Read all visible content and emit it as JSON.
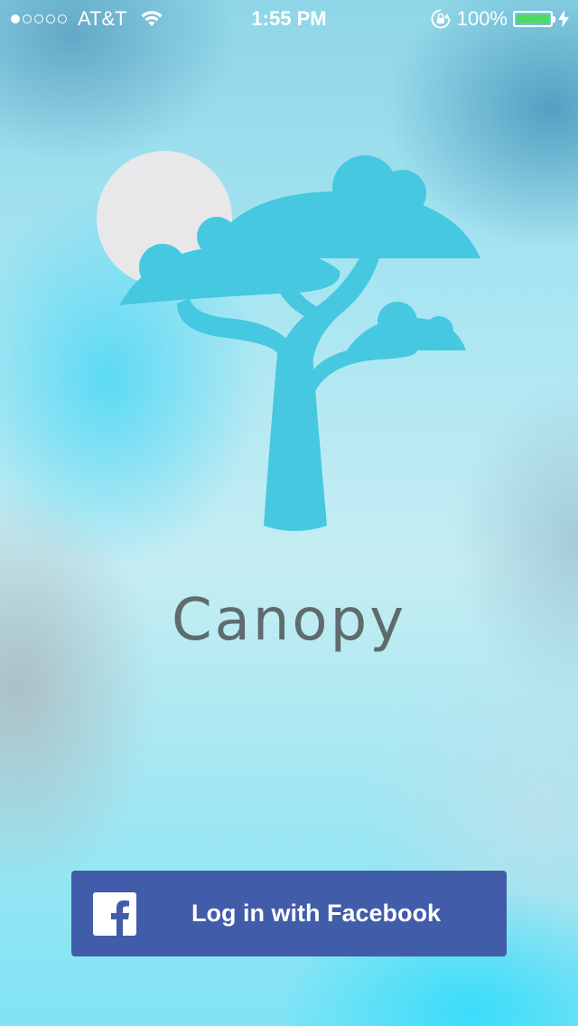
{
  "status_bar": {
    "signal_dots_filled": 1,
    "signal_dots_total": 5,
    "carrier": "AT&T",
    "wifi_icon": "wifi-icon",
    "time": "1:55 PM",
    "rotation_lock_icon": "rotation-lock-icon",
    "battery_percent": "100%",
    "battery_level": 1.0,
    "charging_icon": "charging-bolt-icon"
  },
  "logo": {
    "icon": "canopy-tree-icon",
    "tree_color": "#45c8e0",
    "sun_color": "#e8e8ea"
  },
  "app": {
    "name": "Canopy"
  },
  "login": {
    "facebook_label": "Log in with Facebook",
    "facebook_icon": "facebook-icon",
    "brand_color": "#415ca9"
  }
}
